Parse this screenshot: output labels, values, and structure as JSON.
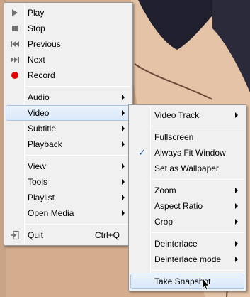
{
  "main_menu": {
    "items": [
      {
        "label": "Play",
        "icon": "play-icon"
      },
      {
        "label": "Stop",
        "icon": "stop-icon"
      },
      {
        "label": "Previous",
        "icon": "previous-icon"
      },
      {
        "label": "Next",
        "icon": "next-icon"
      },
      {
        "label": "Record",
        "icon": "record-icon"
      },
      {
        "label": "Audio"
      },
      {
        "label": "Video"
      },
      {
        "label": "Subtitle"
      },
      {
        "label": "Playback"
      },
      {
        "label": "View"
      },
      {
        "label": "Tools"
      },
      {
        "label": "Playlist"
      },
      {
        "label": "Open Media"
      },
      {
        "label": "Quit",
        "shortcut": "Ctrl+Q",
        "icon": "quit-icon"
      }
    ]
  },
  "video_submenu": {
    "items": [
      {
        "label": "Video Track"
      },
      {
        "label": "Fullscreen"
      },
      {
        "label": "Always Fit Window",
        "checked": true
      },
      {
        "label": "Set as Wallpaper"
      },
      {
        "label": "Zoom"
      },
      {
        "label": "Aspect Ratio"
      },
      {
        "label": "Crop"
      },
      {
        "label": "Deinterlace"
      },
      {
        "label": "Deinterlace mode"
      },
      {
        "label": "Take Snapshot"
      }
    ]
  },
  "colors": {
    "highlight": "#d9e8f9",
    "record": "#e00000",
    "menu_bg": "#f0f0f0"
  }
}
